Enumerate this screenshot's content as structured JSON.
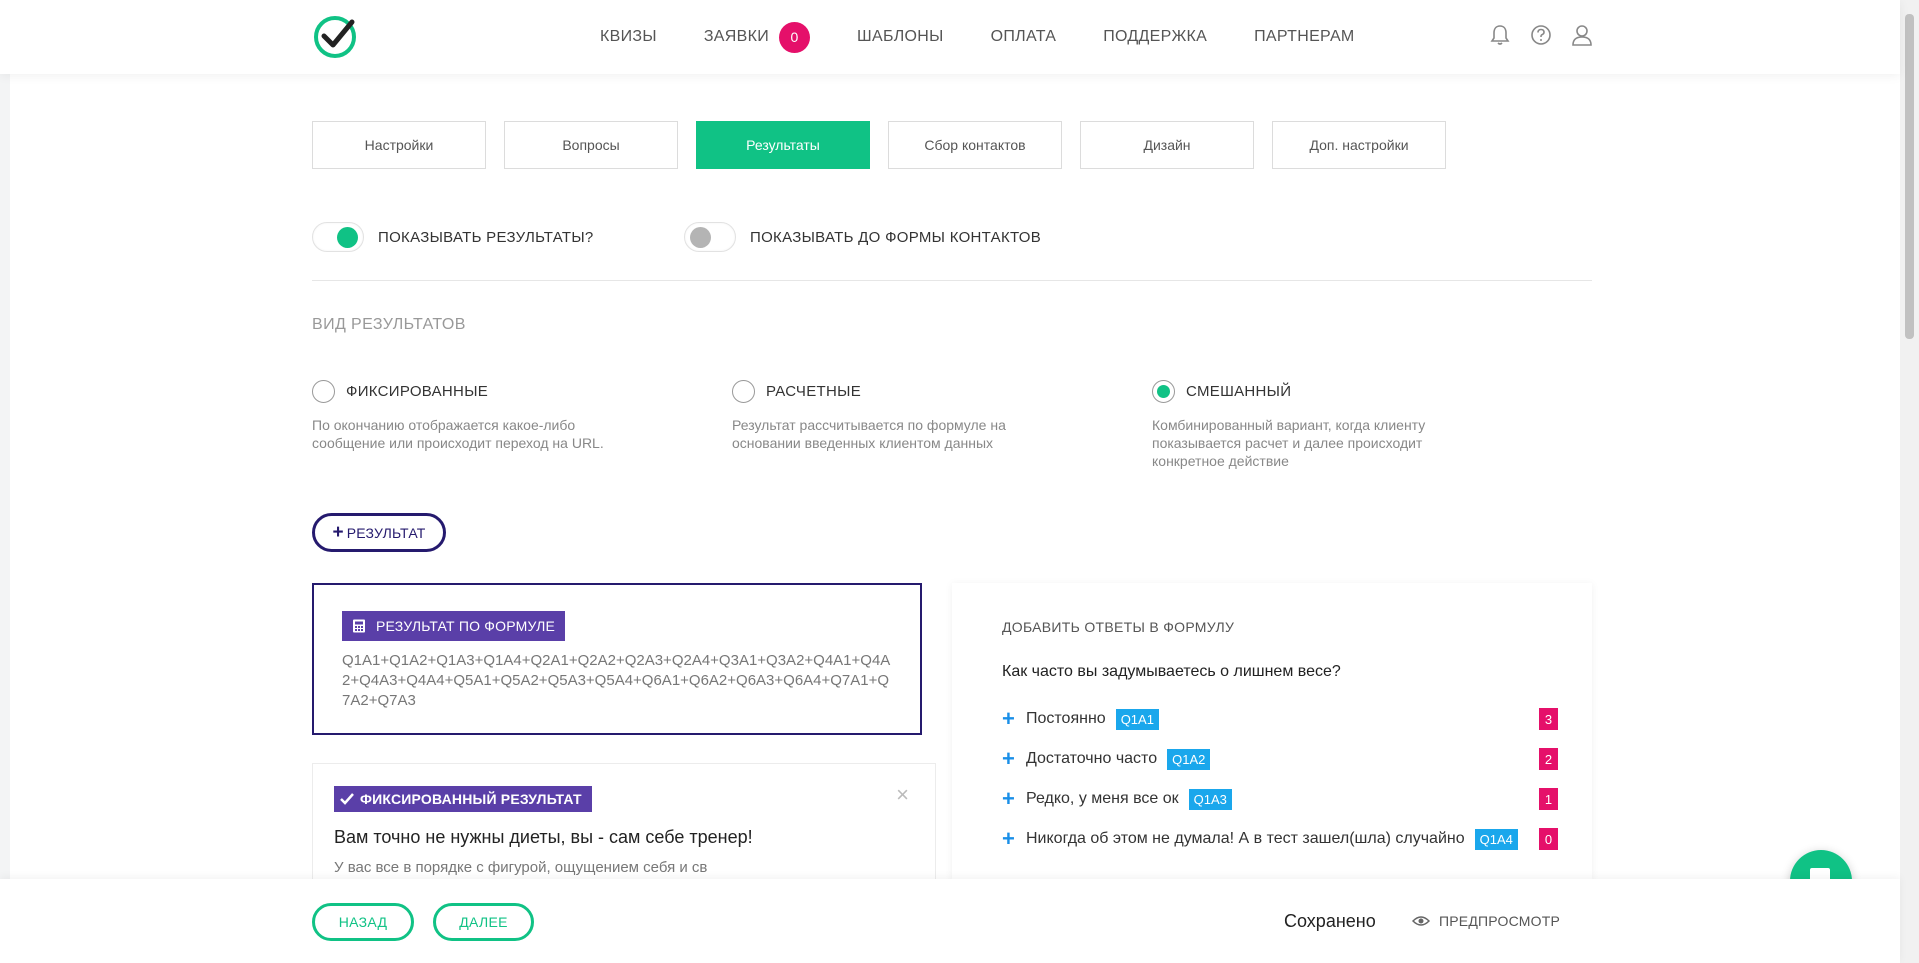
{
  "nav": {
    "items": [
      {
        "label": "КВИЗЫ"
      },
      {
        "label": "ЗАЯВКИ",
        "badge": "0"
      },
      {
        "label": "ШАБЛОНЫ"
      },
      {
        "label": "ОПЛАТА"
      },
      {
        "label": "ПОДДЕРЖКА"
      },
      {
        "label": "ПАРТНЕРАМ"
      }
    ],
    "icons": [
      "bell-icon",
      "help-icon",
      "user-icon"
    ]
  },
  "tabs": [
    {
      "label": "Настройки"
    },
    {
      "label": "Вопросы"
    },
    {
      "label": "Результаты",
      "active": true
    },
    {
      "label": "Сбор контактов"
    },
    {
      "label": "Дизайн"
    },
    {
      "label": "Доп. настройки"
    }
  ],
  "toggles": {
    "show_results": {
      "label": "ПОКАЗЫВАТЬ РЕЗУЛЬТАТЫ?",
      "on": true
    },
    "show_before_form": {
      "label": "ПОКАЗЫВАТЬ ДО ФОРМЫ КОНТАКТОВ",
      "on": false
    }
  },
  "results_type": {
    "title": "ВИД РЕЗУЛЬТАТОВ",
    "options": [
      {
        "label": "ФИКСИРОВАННЫЕ",
        "desc": "По окончанию отображается какое-либо сообщение или происходит переход на URL.",
        "checked": false
      },
      {
        "label": "РАСЧЕТНЫЕ",
        "desc": "Результат рассчитывается по формуле на основании введенных клиентом данных",
        "checked": false
      },
      {
        "label": "СМЕШАННЫЙ",
        "desc": "Комбинированный вариант, когда клиенту показывается расчет и далее происходит конкретное действие",
        "checked": true
      }
    ]
  },
  "add_result_label": "РЕЗУЛЬТАТ",
  "formula_card": {
    "tag": "РЕЗУЛЬТАТ ПО ФОРМУЛЕ",
    "formula": "Q1A1+Q1A2+Q1A3+Q1A4+Q2A1+Q2A2+Q2A3+Q2A4+Q3A1+Q3A2+Q4A1+Q4A2+Q4A3+Q4A4+Q5A1+Q5A2+Q5A3+Q5A4+Q6A1+Q6A2+Q6A3+Q6A4+Q7A1+Q7A2+Q7A3"
  },
  "fixed_card": {
    "tag": "ФИКСИРОВАННЫЙ РЕЗУЛЬТАТ",
    "title": "Вам точно не нужны диеты, вы - сам себе тренер!",
    "desc": "У вас все в порядке с фигурой, ощущением себя и св"
  },
  "answers": {
    "title": "ДОБАВИТЬ ОТВЕТЫ В ФОРМУЛУ",
    "question": "Как часто вы задумываетесь о лишнем весе?",
    "items": [
      {
        "text": "Постоянно",
        "code": "Q1A1",
        "count": "3"
      },
      {
        "text": "Достаточно часто",
        "code": "Q1A2",
        "count": "2"
      },
      {
        "text": "Редко, у меня все ок",
        "code": "Q1A3",
        "count": "1"
      },
      {
        "text": "Никогда об этом не думала! А в тест зашел(шла) случайно",
        "code": "Q1A4",
        "count": "0"
      }
    ]
  },
  "footer": {
    "back": "НАЗАД",
    "next": "ДАЛЕЕ",
    "saved": "Сохранено",
    "preview": "ПРЕДПРОСМОТР"
  },
  "colors": {
    "accent": "#10c285",
    "primary_dark": "#251a6e",
    "purple": "#5a3fa8",
    "badge": "#e5106a",
    "code_blue": "#1aa7ec"
  }
}
